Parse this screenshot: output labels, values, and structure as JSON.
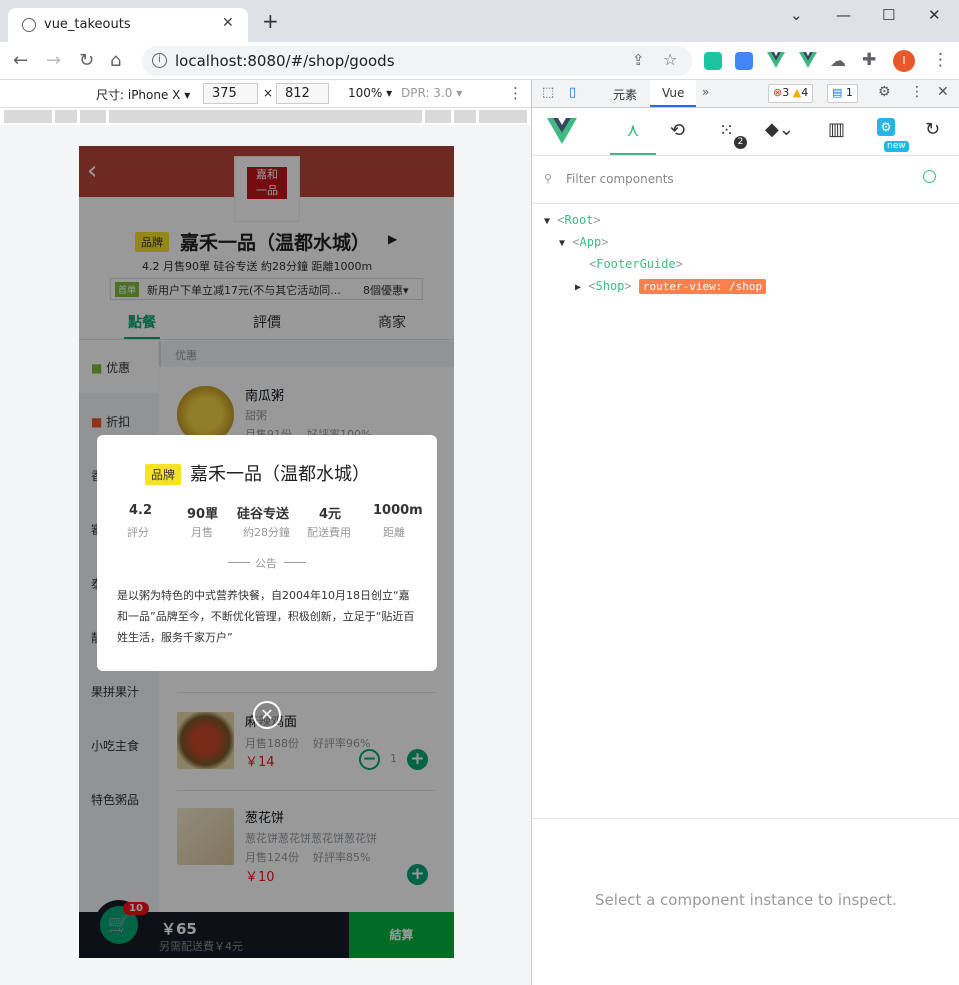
{
  "browser": {
    "tab_title": "vue_takeouts",
    "url": "localhost:8080/#/shop/goods"
  },
  "device_toolbar": {
    "device": "尺寸: iPhone X",
    "width": "375",
    "times": "×",
    "height": "812",
    "zoom": "100%",
    "dpr": "DPR: 3.0"
  },
  "shop": {
    "brand_badge": "品牌",
    "name": "嘉禾一品（温都水城）",
    "info_line": "4.2   月售90單   硅谷专送 約28分鐘   距離1000m",
    "promo_tag": "首单",
    "promo_text": "新用户下单立减17元(不与其它活动同...",
    "promo_count": "8個優惠",
    "tabs": [
      "點餐",
      "評價",
      "商家"
    ],
    "sidebar": [
      "优惠",
      "折扣",
      "香",
      "審",
      "泰",
      "靓",
      "果拼果汁",
      "小吃主食",
      "特色粥品"
    ],
    "category_header": "优惠",
    "foods": [
      {
        "name": "南瓜粥",
        "desc": "甜粥",
        "sales": "月售91份",
        "rating": "好評率100%"
      },
      {
        "name": "麻辣鸡面",
        "sales": "月售188份",
        "rating": "好評率96%",
        "price": "￥14",
        "count": "1"
      },
      {
        "name": "葱花饼",
        "desc": "葱花饼葱花饼葱花饼葱花饼",
        "sales": "月售124份",
        "rating": "好評率85%",
        "price": "￥10"
      }
    ],
    "cart": {
      "count": "10",
      "total": "￥65",
      "delivery": "另需配送費￥4元",
      "checkout": "結算"
    }
  },
  "modal": {
    "badge": "品牌",
    "name": "嘉禾一品（温都水城）",
    "stats": [
      {
        "value": "4.2",
        "label": "評分"
      },
      {
        "value": "90單",
        "label": "月售"
      },
      {
        "value": "硅谷专送",
        "label": "約28分鐘"
      },
      {
        "value": "4元",
        "label": "配送費用"
      },
      {
        "value": "1000m",
        "label": "距離"
      }
    ],
    "notice_title": "公告",
    "notice_text": "是以粥为特色的中式营养快餐，自2004年10月18日创立“嘉和一品”品牌至今，不断优化管理，积极创新，立足于“贴近百姓生活，服务千家万户”"
  },
  "devtools": {
    "tabs": [
      "元素",
      "Vue"
    ],
    "errors": "3",
    "warnings": "4",
    "messages": "1",
    "timeline_badge": "2",
    "new_badge": "new",
    "filter_placeholder": "Filter components",
    "tree": [
      {
        "lt": "<",
        "tag": "Root",
        "gt": ">"
      },
      {
        "lt": "<",
        "tag": "App",
        "gt": ">"
      },
      {
        "lt": "<",
        "tag": "FooterGuide",
        "gt": ">"
      },
      {
        "lt": "<",
        "tag": "Shop",
        "gt": ">",
        "route": "router-view: /shop"
      }
    ],
    "inspect_hint": "Select a component instance to inspect."
  },
  "colors": {
    "green": "#02a774",
    "vue": "#42b983",
    "route": "#ff7f50"
  }
}
